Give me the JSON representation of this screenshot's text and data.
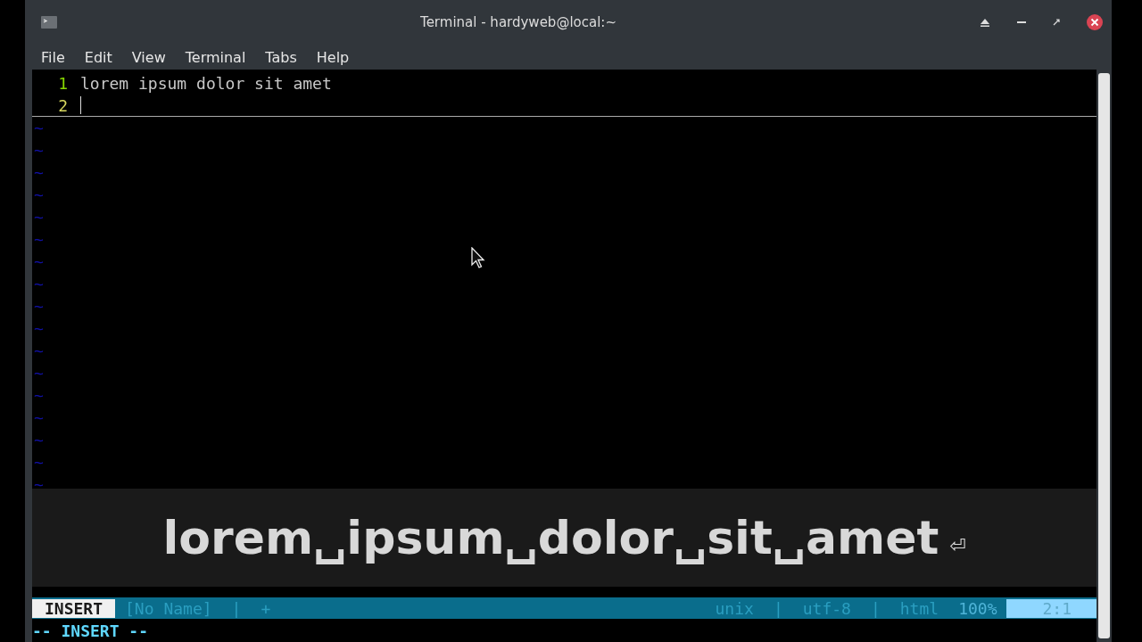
{
  "window": {
    "title": "Terminal - hardyweb@local:~"
  },
  "menu": [
    "File",
    "Edit",
    "View",
    "Terminal",
    "Tabs",
    "Help"
  ],
  "editor": {
    "lines": [
      {
        "number": "1",
        "text": "lorem ipsum dolor sit amet",
        "current": false
      },
      {
        "number": "2",
        "current": true
      }
    ],
    "tildes": [
      "~",
      "~",
      "~",
      "~",
      "~",
      "~",
      "~",
      "~",
      "~",
      "~",
      "~",
      "~",
      "~",
      "~",
      "~",
      "~",
      "~"
    ]
  },
  "status_line": {
    "left": [
      {
        "text": "INSERT",
        "kind": "mode"
      },
      {
        "text": "[No Name]",
        "kind": "plain"
      },
      {
        "text": "|",
        "kind": "plain"
      },
      {
        "text": "+",
        "kind": "plain"
      }
    ],
    "right": [
      {
        "text": "unix",
        "kind": "plain"
      },
      {
        "text": "|",
        "kind": "plain"
      },
      {
        "text": "utf-8",
        "kind": "plain"
      },
      {
        "text": "|",
        "kind": "plain"
      },
      {
        "text": "html",
        "kind": "plain"
      },
      {
        "text": "100%",
        "kind": "percent"
      },
      {
        "text": "2:1",
        "kind": "position"
      }
    ]
  },
  "command_line": "-- INSERT --",
  "key_overlay": {
    "keys": "lorem␣ipsum␣dolor␣sit␣amet",
    "enter": "⏎"
  }
}
